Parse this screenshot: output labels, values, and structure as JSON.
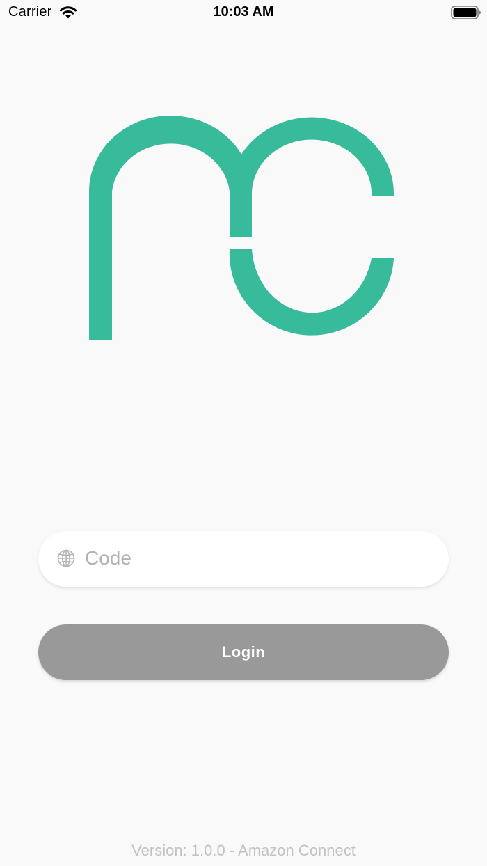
{
  "status_bar": {
    "carrier": "Carrier",
    "time": "10:03 AM",
    "wifi_icon": "wifi-icon",
    "battery_icon": "battery-icon",
    "battery_level": 1.0
  },
  "logo": {
    "icon": "mc-logo",
    "color": "#37bb9a"
  },
  "code_field": {
    "icon": "globe-icon",
    "placeholder": "Code",
    "value": ""
  },
  "login": {
    "label": "Login",
    "color": "#999999"
  },
  "footer": {
    "version_text": "Version: 1.0.0 - Amazon Connect"
  }
}
